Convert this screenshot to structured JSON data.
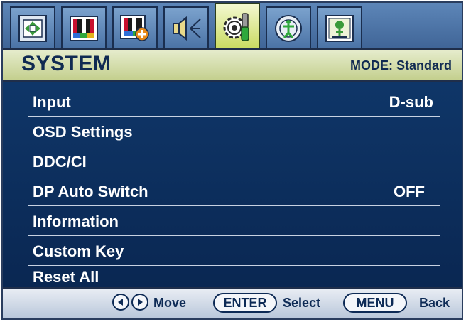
{
  "tabs": [
    {
      "icon": "display-position-icon"
    },
    {
      "icon": "picture-icon"
    },
    {
      "icon": "picture-advanced-icon"
    },
    {
      "icon": "audio-icon"
    },
    {
      "icon": "system-icon",
      "active": true
    },
    {
      "icon": "eco-icon"
    },
    {
      "icon": "save-settings-icon"
    }
  ],
  "header": {
    "title": "SYSTEM",
    "mode": "MODE: Standard"
  },
  "menu": {
    "items": [
      {
        "label": "Input",
        "value": "D-sub"
      },
      {
        "label": "OSD Settings",
        "value": ""
      },
      {
        "label": "DDC/CI",
        "value": ""
      },
      {
        "label": "DP Auto Switch",
        "value": "OFF"
      },
      {
        "label": "Information",
        "value": ""
      },
      {
        "label": "Custom Key",
        "value": ""
      },
      {
        "label": "Reset All",
        "value": ""
      }
    ]
  },
  "footer": {
    "move_label": "Move",
    "enter_key": "ENTER",
    "select_label": "Select",
    "menu_key": "MENU",
    "back_label": "Back"
  },
  "colors": {
    "active_tab": "#d9e68a",
    "menu_bg": "#0d2c59",
    "header_bg": "#d6dfae",
    "text_dark": "#102a52"
  }
}
